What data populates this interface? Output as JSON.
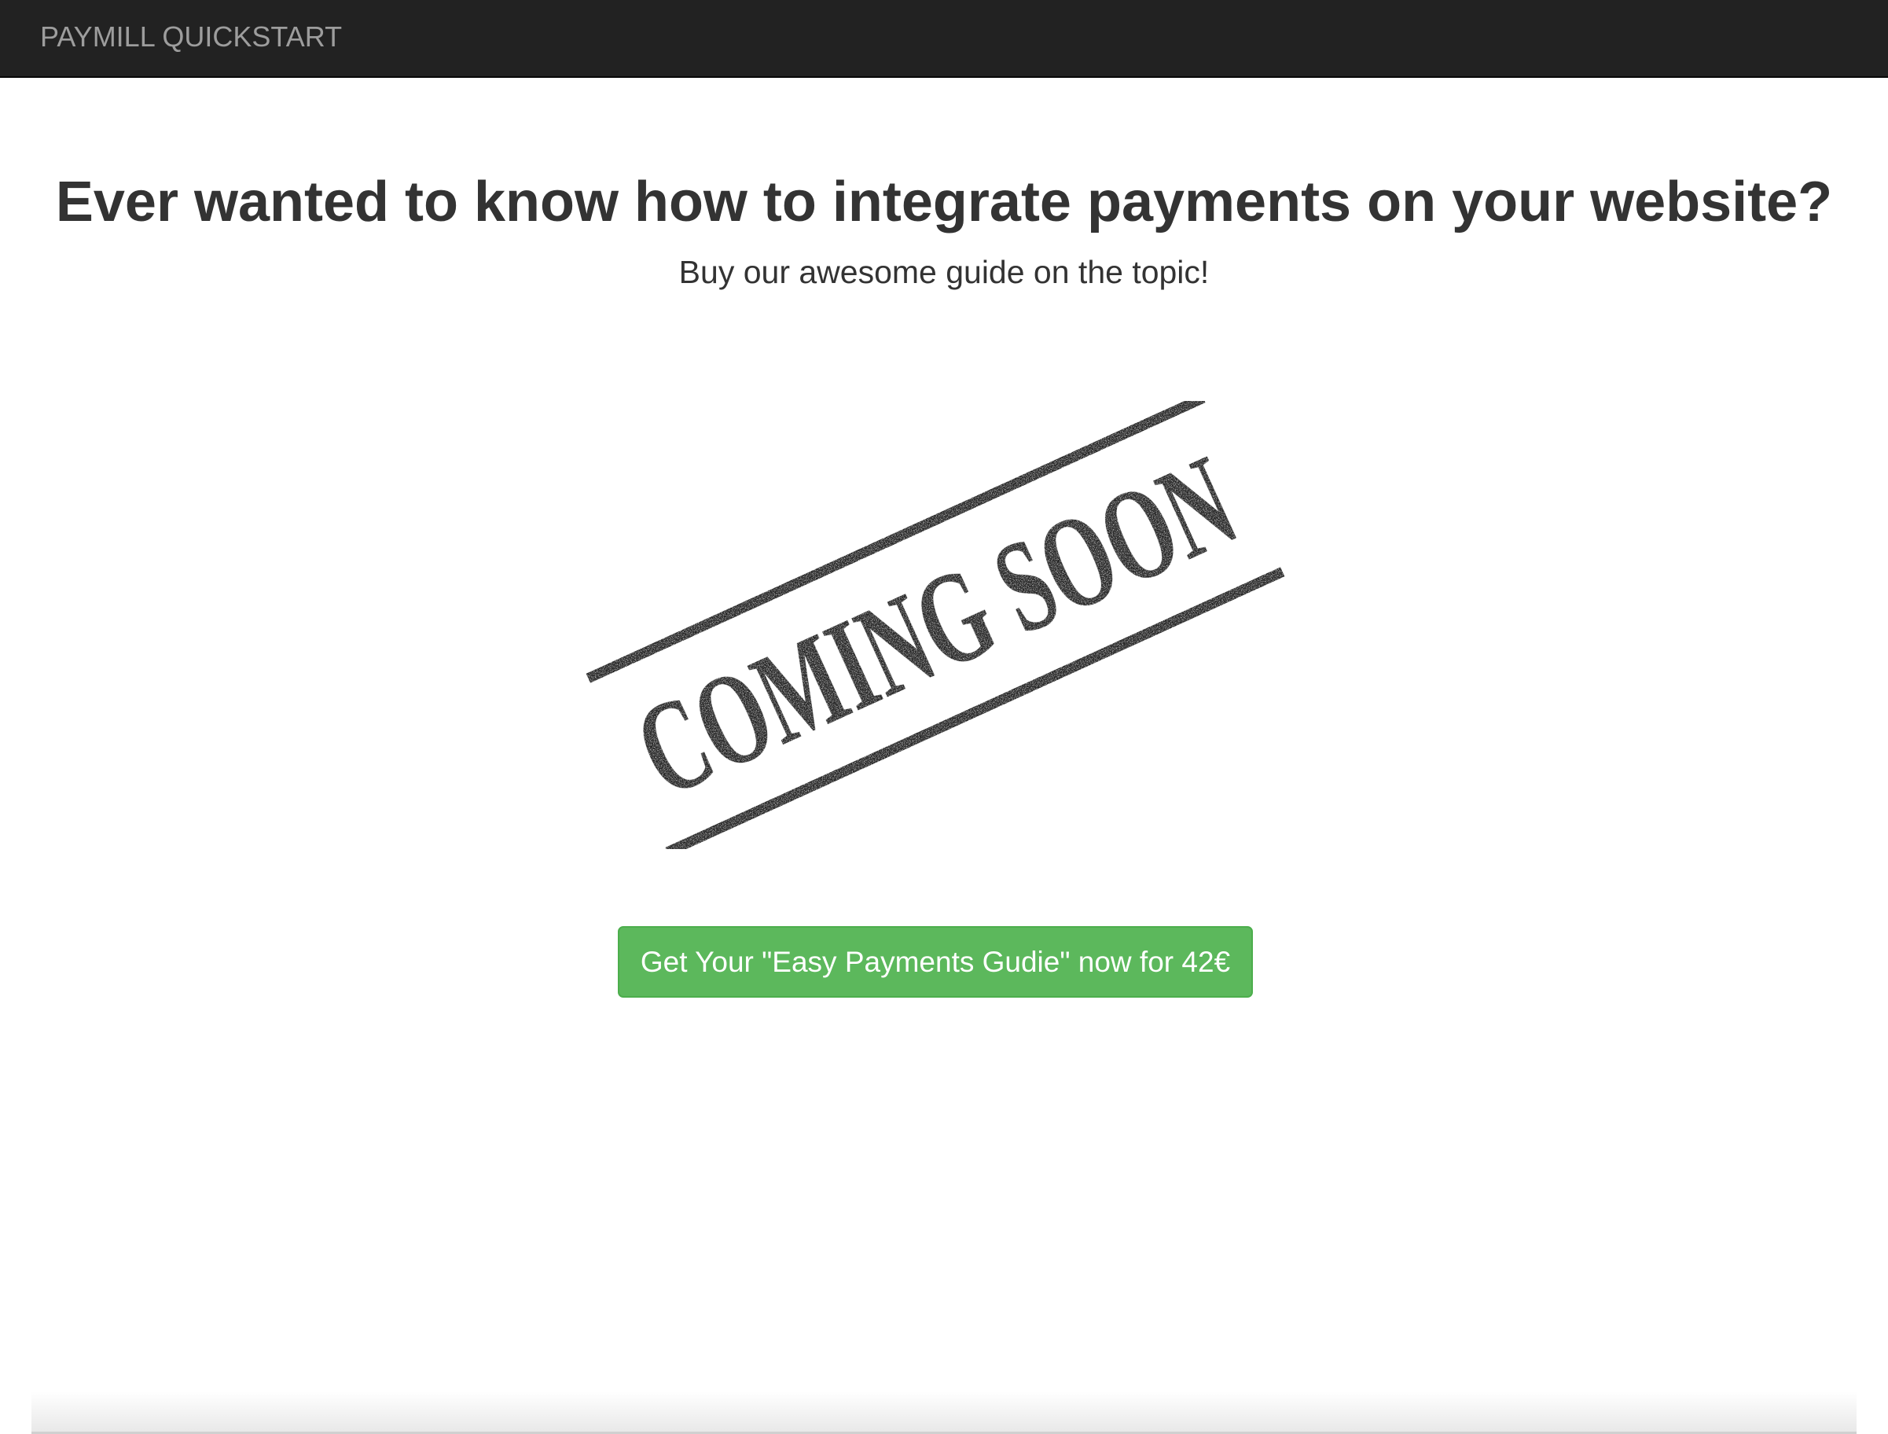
{
  "navbar": {
    "brand": "PAYMILL QUICKSTART",
    "background_color": "#222222",
    "brand_color": "#9d9d9d"
  },
  "hero": {
    "title": "Ever wanted to know how to integrate payments on your website?",
    "subtitle": "Buy our awesome guide on the topic!"
  },
  "stamp": {
    "text": "COMING SOON",
    "icon": "coming-soon-stamp"
  },
  "cta": {
    "label": "Get Your \"Easy Payments Gudie\" now for 42€",
    "color": "#5cb85c"
  }
}
